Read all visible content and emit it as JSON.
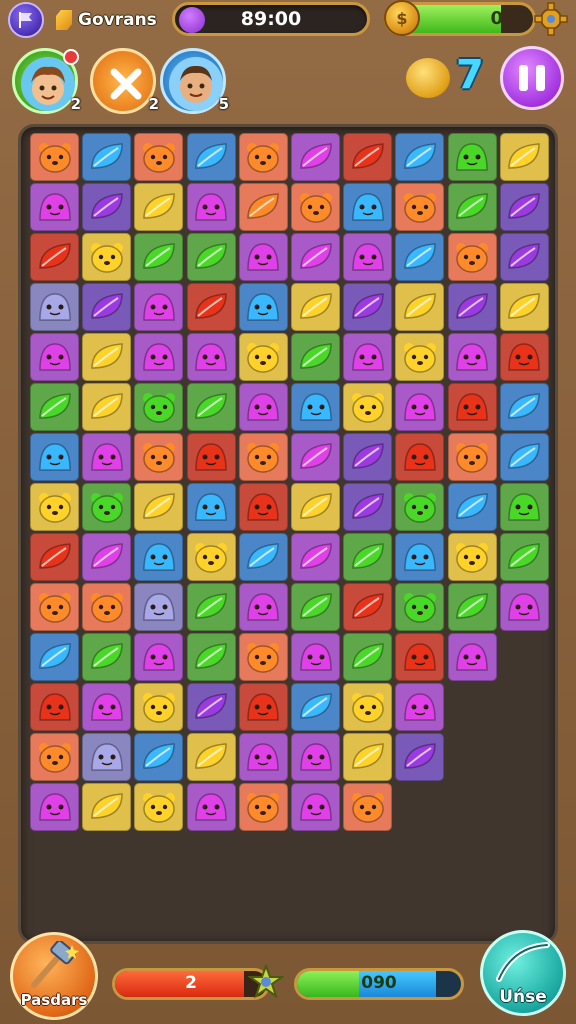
{
  "header": {
    "player_name": "Govrans",
    "score": "89:00",
    "energy_value": "0",
    "energy_fraction": 0.78
  },
  "players": [
    {
      "name": "player-1",
      "count": "2",
      "ring": "#3fb81c"
    },
    {
      "name": "opponent-x",
      "count": "2",
      "ring": "#ff9a1a"
    },
    {
      "name": "player-3",
      "count": "5",
      "ring": "#2a88d8"
    }
  ],
  "coins": "7",
  "board": {
    "rows": [
      "hb-o,lf-c,hb-o,lf-c,hb-o,lf-m,lf-r,lf-c,sl-g,lf-y",
      "sl-m,lf-v,lf-y,sl-m,lf-o,hb-o,sl-c,hb-o,lf-g,lf-v",
      "lf-r,hb-y,lf-g,lf-g,sl-m,lf-m,sl-m,lf-c,hb-o,lf-v",
      "sl-l,lf-v,sl-m,lf-r,sl-c,lf-y,lf-v,lf-y,lf-v,lf-y",
      "sl-m,lf-y,sl-m,sl-m,hb-y,lf-g,sl-m,hb-y,sl-m,sl-r",
      "lf-g,lf-y,hb-g,lf-g,sl-m,sl-c,hb-y,sl-m,sl-r,lf-c",
      "sl-c,sl-m,hb-o,sl-r,hb-o,lf-m,lf-v,sl-r,hb-o,lf-c",
      "hb-y,hb-g,lf-y,sl-c,sl-r,lf-y,lf-v,hb-g,lf-c,sl-g",
      "lf-r,lf-m,sl-c,hb-y,lf-c,lf-m,lf-g,sl-c,hb-y,lf-g",
      "hb-o,hb-o,sl-l,lf-g,sl-m,lf-g,lf-r,hb-g,lf-g,sl-m",
      "lf-c,lf-g,sl-m,lf-g,hb-o,sl-m,lf-g,sl-r,sl-m",
      "sl-r,sl-m,hb-y,lf-v,sl-r,lf-c,hb-y,sl-m",
      "hb-o,sl-l,lf-c,lf-y,sl-m,sl-m,lf-y,lf-v",
      "sl-m,lf-y,hb-y,sl-m,hb-o,sl-m,hb-o"
    ]
  },
  "bottom": {
    "boost_label": "Pasdars",
    "red_value": "2",
    "red_fraction": 0.85,
    "green_value": "090",
    "green_fraction": 0.38,
    "blue_fraction": 0.47,
    "use_label": "Uńse"
  },
  "colors": {
    "tile_bgs": {
      "o": "#e67a5a",
      "c": "#4a86c8",
      "m": "#a85ac8",
      "g": "#5fa84a",
      "y": "#e0c04a",
      "r": "#c84a3a",
      "v": "#7a5ab8",
      "l": "#8a86c0"
    }
  }
}
